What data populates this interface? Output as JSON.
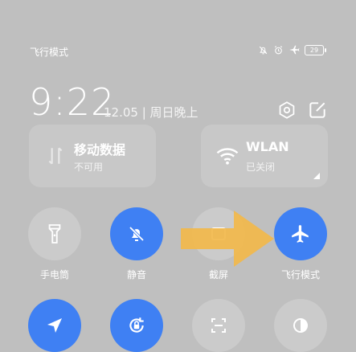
{
  "status_bar": {
    "mode_label": "飞行模式",
    "icons": [
      "bell-off-icon",
      "alarm-icon",
      "airplane-icon",
      "battery-icon"
    ],
    "battery_level": "29"
  },
  "header": {
    "time": "9:22",
    "date": "12.05 | 周日晚上"
  },
  "tiles": {
    "mobile_data": {
      "title": "移动数据",
      "status": "不可用",
      "icon": "mobile-data-icon"
    },
    "wlan": {
      "title": "WLAN",
      "status": "已关闭",
      "icon": "wifi-icon"
    }
  },
  "toggles": [
    {
      "label": "手电筒",
      "icon": "flashlight-icon",
      "active": false
    },
    {
      "label": "静音",
      "icon": "bell-off-icon",
      "active": true
    },
    {
      "label": "截屏",
      "icon": "screenshot-icon",
      "active": false
    },
    {
      "label": "飞行模式",
      "icon": "airplane-icon",
      "active": true
    }
  ],
  "toggles_row2": [
    {
      "icon": "location-icon",
      "active": true
    },
    {
      "icon": "rotation-lock-icon",
      "active": true
    },
    {
      "icon": "scan-icon",
      "active": false
    },
    {
      "icon": "dark-mode-icon",
      "active": false
    }
  ],
  "colors": {
    "background": "#bfbfbf",
    "tile": "#c8c8c8",
    "active": "#3f80f3",
    "arrow": "#f2b84b"
  }
}
